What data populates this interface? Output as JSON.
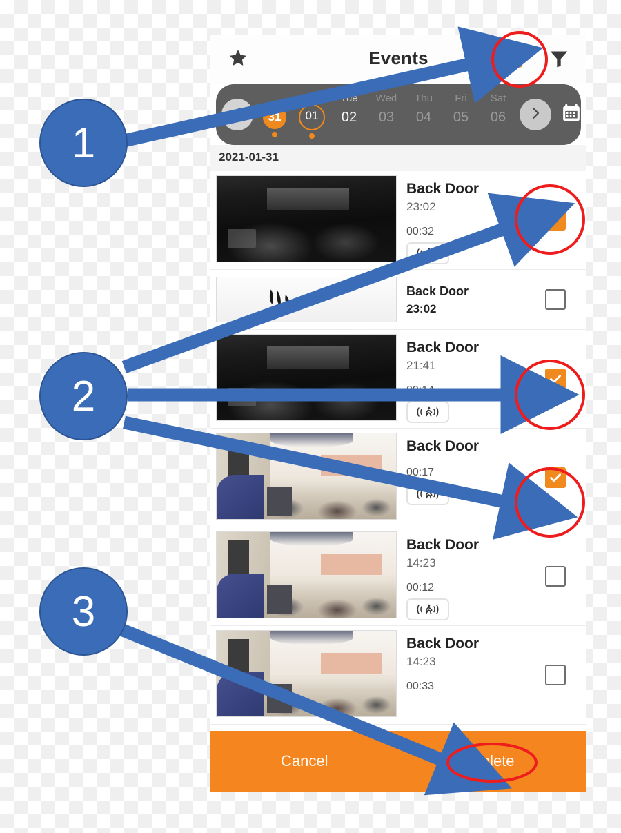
{
  "app": {
    "title": "Events",
    "star_icon": "star-icon",
    "trash_icon": "trash-icon",
    "filter_icon": "filter-icon"
  },
  "datestrip": {
    "prev_label": "‹",
    "next_label": "›",
    "calendar_icon": "calendar-icon",
    "days": [
      {
        "dow": "",
        "num": "31",
        "style": "filled",
        "dot": true
      },
      {
        "dow": "",
        "num": "01",
        "style": "outlined",
        "dot": true
      },
      {
        "dow": "Tue",
        "num": "02",
        "style": "bright",
        "dot": false
      },
      {
        "dow": "Wed",
        "num": "03",
        "style": "dim",
        "dot": false
      },
      {
        "dow": "Thu",
        "num": "04",
        "style": "dim",
        "dot": false
      },
      {
        "dow": "Fri",
        "num": "05",
        "style": "dim",
        "dot": false
      },
      {
        "dow": "Sat",
        "num": "06",
        "style": "dim",
        "dot": false
      }
    ]
  },
  "date_header": "2021-01-31",
  "events": [
    {
      "camera": "Back Door",
      "time": "23:02",
      "duration": "00:32",
      "badge": "motion-icon",
      "checked": true,
      "thumb": "night",
      "variant": "full"
    },
    {
      "camera": "Back Door",
      "time": "23:02",
      "duration": "",
      "badge": "",
      "checked": false,
      "thumb": "scribble",
      "variant": "short"
    },
    {
      "camera": "Back Door",
      "time": "21:41",
      "duration": "00:14",
      "badge": "motion-icon",
      "checked": true,
      "thumb": "night",
      "variant": "full"
    },
    {
      "camera": "Back Door",
      "time": "",
      "duration": "00:17",
      "badge": "motion-icon",
      "checked": true,
      "thumb": "day",
      "variant": "full"
    },
    {
      "camera": "Back Door",
      "time": "14:23",
      "duration": "00:12",
      "badge": "motion-icon",
      "checked": false,
      "thumb": "day",
      "variant": "full"
    },
    {
      "camera": "Back Door",
      "time": "14:23",
      "duration": "00:33",
      "badge": "",
      "checked": false,
      "thumb": "day",
      "variant": "full"
    }
  ],
  "bottombar": {
    "cancel_label": "Cancel",
    "delete_label": "Delete"
  },
  "annotations": {
    "callouts": [
      {
        "label": "1"
      },
      {
        "label": "2"
      },
      {
        "label": "3"
      }
    ]
  },
  "colors": {
    "accent_orange": "#f5851f",
    "callout_blue": "#3a6cb8",
    "highlight_red": "#ee1c1c",
    "strip_gray": "#5e5e5e"
  }
}
